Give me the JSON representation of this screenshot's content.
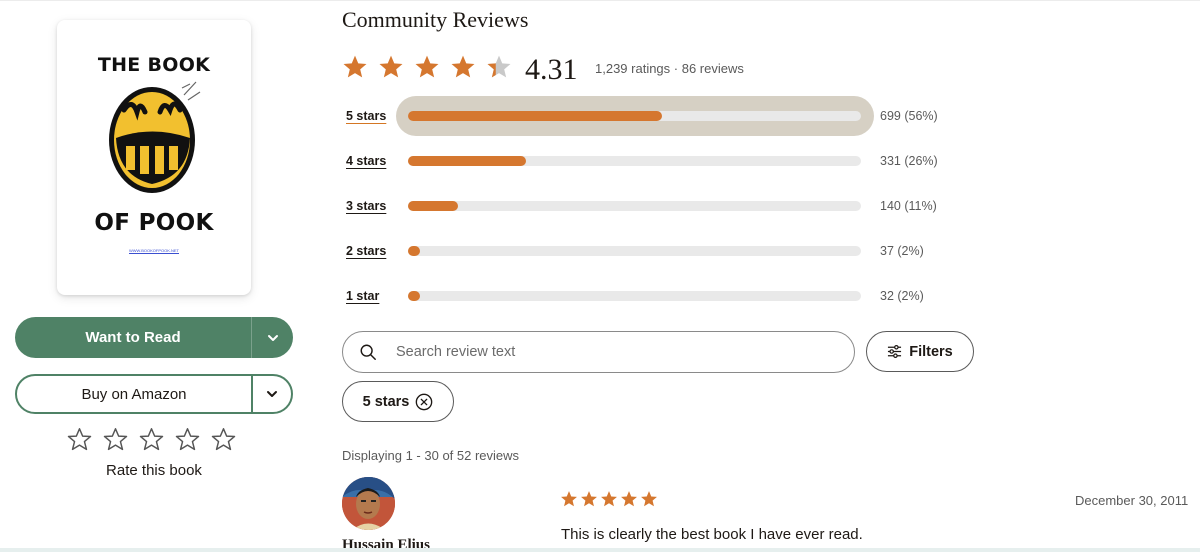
{
  "book": {
    "cover_title_top": "THE BOOK",
    "cover_title_bottom": "OF POOK",
    "cover_url": "WWW.BOOKOFPOOK.NET"
  },
  "actions": {
    "want_to_read": "Want to Read",
    "buy": "Buy on Amazon",
    "rate_label": "Rate this book",
    "rate_stars": 5
  },
  "reviews_section": {
    "title": "Community Reviews",
    "average": "4.31",
    "average_value": 4.31,
    "meta": "1,239 ratings · 86 reviews",
    "histogram": [
      {
        "label": "5 stars",
        "count": "699 (56%)",
        "fraction": 0.56,
        "selected": true
      },
      {
        "label": "4 stars",
        "count": "331 (26%)",
        "fraction": 0.26,
        "selected": false
      },
      {
        "label": "3 stars",
        "count": "140 (11%)",
        "fraction": 0.11,
        "selected": false
      },
      {
        "label": "2 stars",
        "count": "37 (2%)",
        "fraction": 0.02,
        "selected": false
      },
      {
        "label": "1 star",
        "count": "32 (2%)",
        "fraction": 0.02,
        "selected": false
      }
    ],
    "search_placeholder": "Search review text",
    "filters_label": "Filters",
    "active_chip": "5 stars",
    "displaying": "Displaying 1 - 30 of 52 reviews"
  },
  "review": {
    "reviewer": "Hussain Elius",
    "rating": 5,
    "date": "December 30, 2011",
    "text": "This is clearly the best book I have ever read."
  },
  "colors": {
    "accent": "#d5772f",
    "green": "#4f8266",
    "highlight": "#d6d0c4"
  }
}
